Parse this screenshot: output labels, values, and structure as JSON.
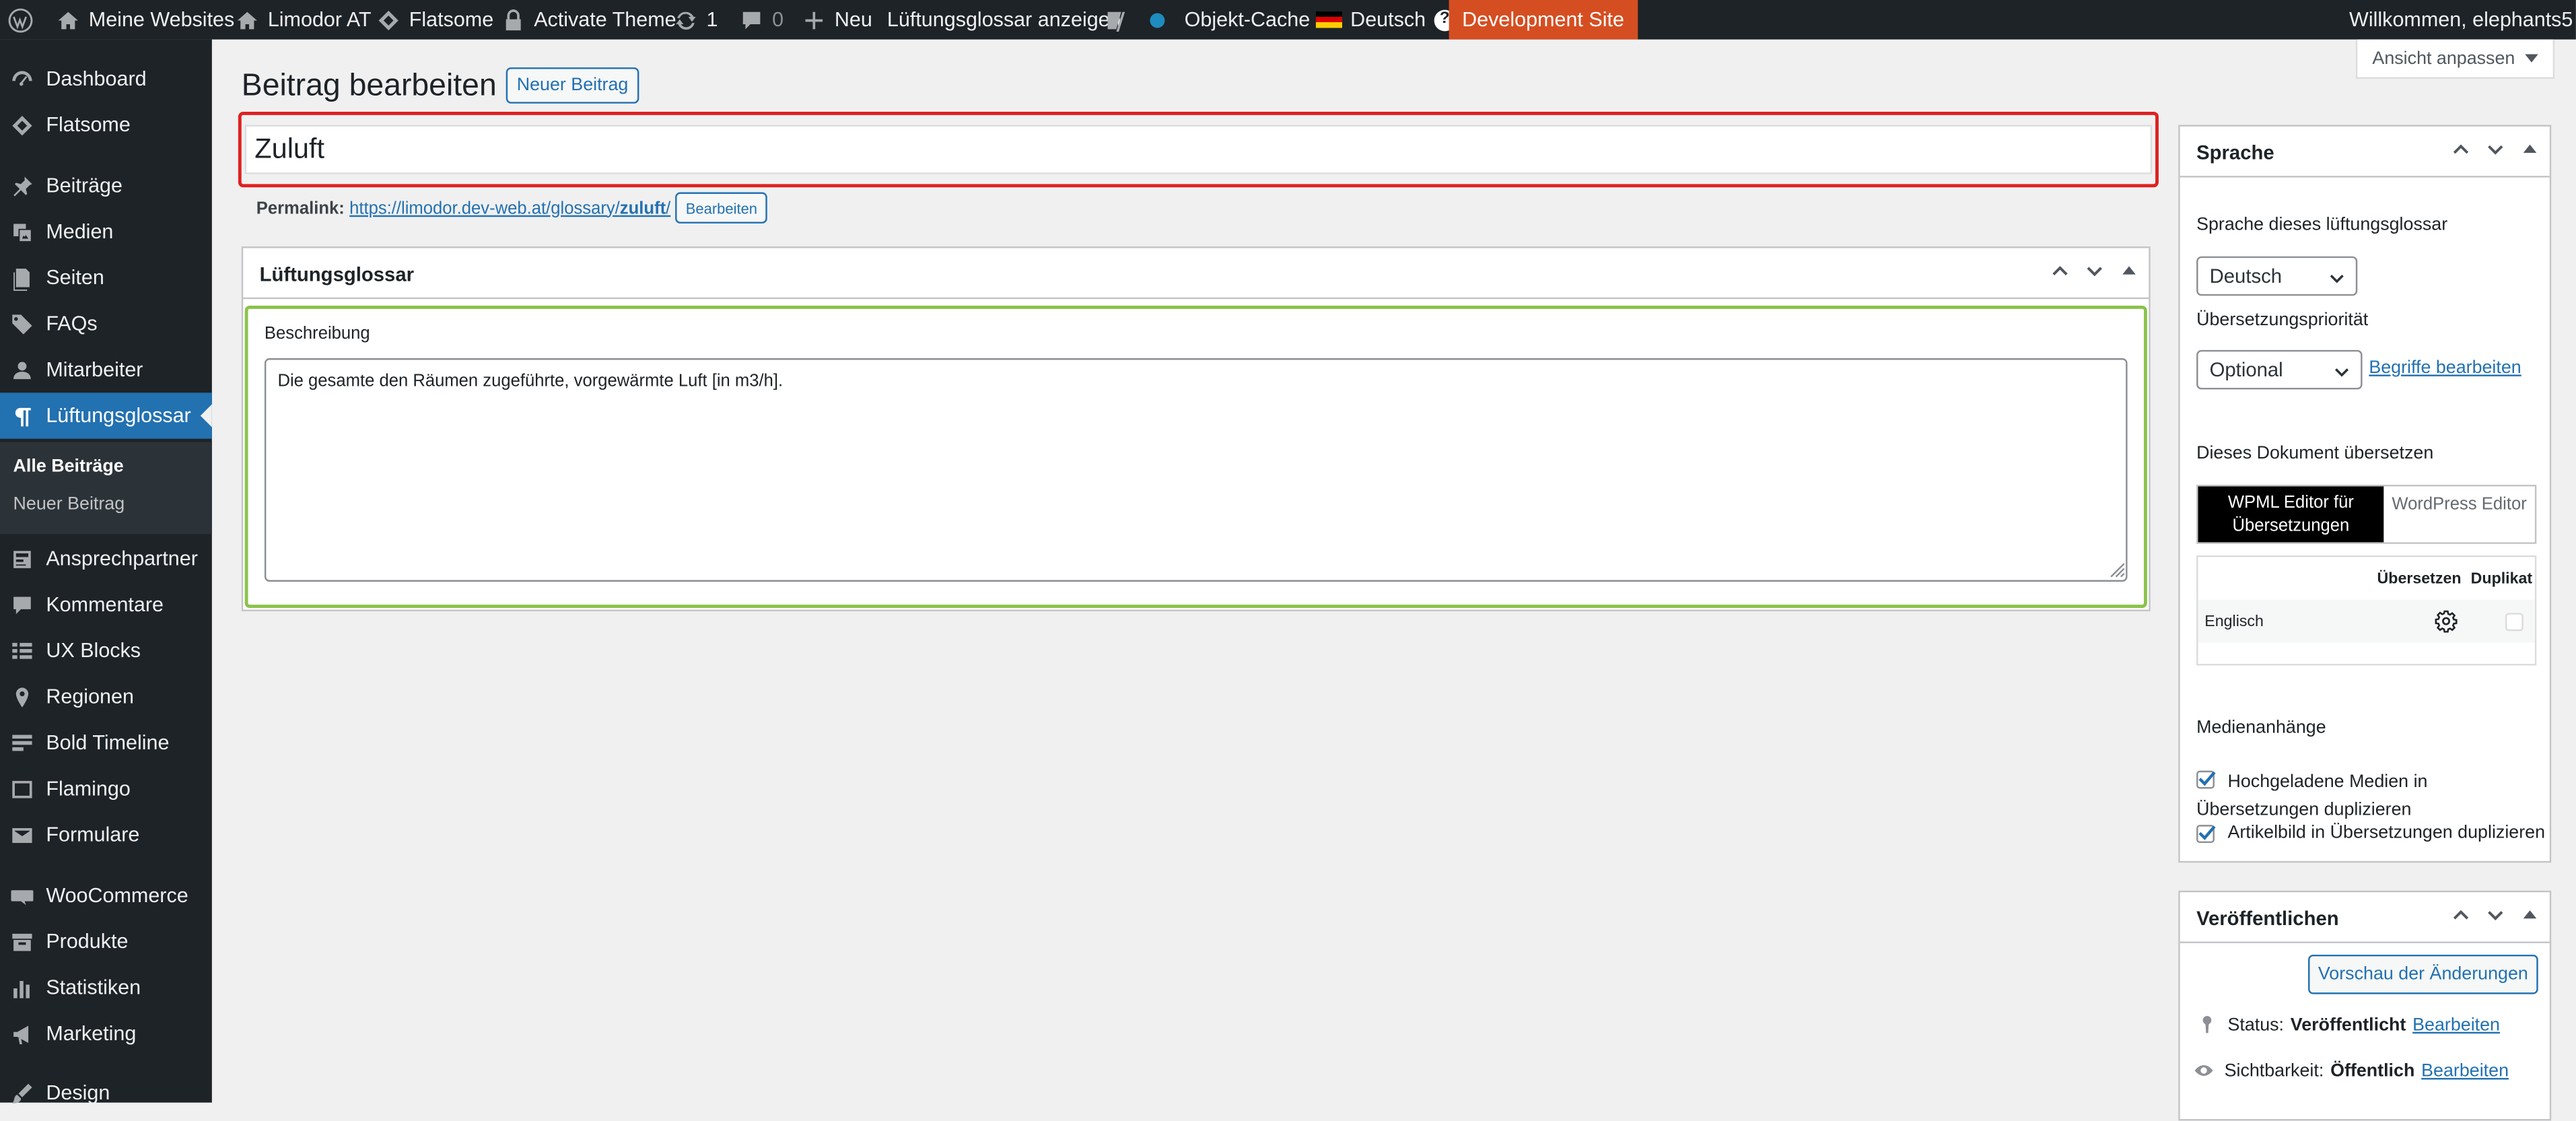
{
  "adminbar": {
    "wp_logo": "wordpress-icon",
    "my_sites": "Meine Websites",
    "site_name": "Limodor AT",
    "flatsome": "Flatsome",
    "activate_theme": "Activate Theme",
    "updates_count": "1",
    "comments_count": "0",
    "new": "Neu",
    "view_glossary": "Lüftungsglossar anzeigen",
    "object_cache": "Objekt-Cache",
    "language": "Deutsch",
    "dev_site": "Development Site",
    "welcome": "Willkommen, elephants5"
  },
  "sidebar": {
    "items": [
      {
        "label": "Dashboard",
        "icon": "dashboard-icon"
      },
      {
        "label": "Flatsome",
        "icon": "flatsome-icon"
      },
      {
        "label": "Beiträge",
        "icon": "pin-icon"
      },
      {
        "label": "Medien",
        "icon": "media-icon"
      },
      {
        "label": "Seiten",
        "icon": "pages-icon"
      },
      {
        "label": "FAQs",
        "icon": "tag-icon"
      },
      {
        "label": "Mitarbeiter",
        "icon": "user-icon"
      },
      {
        "label": "Lüftungsglossar",
        "icon": "paragraph-icon"
      },
      {
        "label": "Ansprechpartner",
        "icon": "contact-icon"
      },
      {
        "label": "Kommentare",
        "icon": "comment-icon"
      },
      {
        "label": "UX Blocks",
        "icon": "blocks-icon"
      },
      {
        "label": "Regionen",
        "icon": "location-icon"
      },
      {
        "label": "Bold Timeline",
        "icon": "timeline-icon"
      },
      {
        "label": "Flamingo",
        "icon": "flamingo-icon"
      },
      {
        "label": "Formulare",
        "icon": "mail-icon"
      },
      {
        "label": "WooCommerce",
        "icon": "woocommerce-icon"
      },
      {
        "label": "Produkte",
        "icon": "archive-icon"
      },
      {
        "label": "Statistiken",
        "icon": "chart-icon"
      },
      {
        "label": "Marketing",
        "icon": "megaphone-icon"
      },
      {
        "label": "Design",
        "icon": "brush-icon"
      }
    ],
    "submenu": {
      "all_posts": "Alle Beiträge",
      "new_post": "Neuer Beitrag"
    }
  },
  "page": {
    "heading": "Beitrag bearbeiten",
    "new_post_button": "Neuer Beitrag",
    "screen_options": "Ansicht anpassen",
    "title_value": "Zuluft",
    "permalink_label": "Permalink:",
    "permalink_base": "https://limodor.dev-web.at/glossary/",
    "permalink_slug": "zuluft",
    "permalink_trailing": "/",
    "permalink_edit": "Bearbeiten"
  },
  "metabox": {
    "title": "Lüftungsglossar",
    "field_label": "Beschreibung",
    "field_value": "Die gesamte den Räumen zugeführte, vorgewärmte Luft [in m3/h]."
  },
  "language_box": {
    "title": "Sprache",
    "lang_label": "Sprache dieses lüftungsglossar",
    "lang_value": "Deutsch",
    "priority_label": "Übersetzungspriorität",
    "priority_value": "Optional",
    "edit_terms": "Begriffe bearbeiten",
    "translate_label": "Dieses Dokument übersetzen",
    "tab_wpml": "WPML Editor für Übersetzungen",
    "tab_wp": "WordPress Editor",
    "col_translate": "Übersetzen",
    "col_duplicate": "Duplikat",
    "row_lang": "Englisch",
    "media_title": "Medienanhänge",
    "media_opt1": "Hochgeladene Medien in Übersetzungen duplizieren",
    "media_opt2": "Artikelbild in Übersetzungen duplizieren"
  },
  "publish_box": {
    "title": "Veröffentlichen",
    "preview_button": "Vorschau der Änderungen",
    "status_label": "Status:",
    "status_value": "Veröffentlicht",
    "status_edit": "Bearbeiten",
    "visibility_label": "Sichtbarkeit:",
    "visibility_value": "Öffentlich",
    "visibility_edit": "Bearbeiten"
  }
}
